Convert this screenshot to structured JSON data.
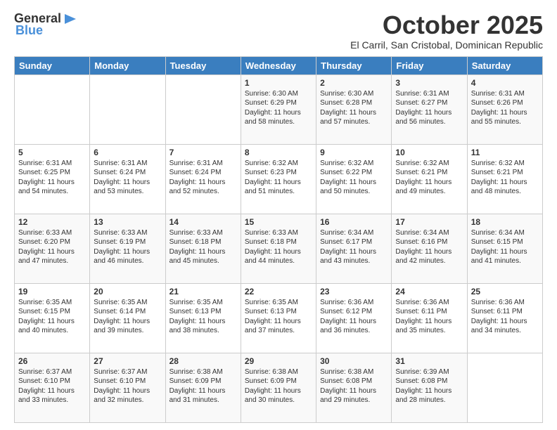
{
  "header": {
    "logo_general": "General",
    "logo_blue": "Blue",
    "month": "October 2025",
    "location": "El Carril, San Cristobal, Dominican Republic"
  },
  "days_of_week": [
    "Sunday",
    "Monday",
    "Tuesday",
    "Wednesday",
    "Thursday",
    "Friday",
    "Saturday"
  ],
  "weeks": [
    [
      {
        "day": "",
        "info": ""
      },
      {
        "day": "",
        "info": ""
      },
      {
        "day": "",
        "info": ""
      },
      {
        "day": "1",
        "info": "Sunrise: 6:30 AM\nSunset: 6:29 PM\nDaylight: 11 hours\nand 58 minutes."
      },
      {
        "day": "2",
        "info": "Sunrise: 6:30 AM\nSunset: 6:28 PM\nDaylight: 11 hours\nand 57 minutes."
      },
      {
        "day": "3",
        "info": "Sunrise: 6:31 AM\nSunset: 6:27 PM\nDaylight: 11 hours\nand 56 minutes."
      },
      {
        "day": "4",
        "info": "Sunrise: 6:31 AM\nSunset: 6:26 PM\nDaylight: 11 hours\nand 55 minutes."
      }
    ],
    [
      {
        "day": "5",
        "info": "Sunrise: 6:31 AM\nSunset: 6:25 PM\nDaylight: 11 hours\nand 54 minutes."
      },
      {
        "day": "6",
        "info": "Sunrise: 6:31 AM\nSunset: 6:24 PM\nDaylight: 11 hours\nand 53 minutes."
      },
      {
        "day": "7",
        "info": "Sunrise: 6:31 AM\nSunset: 6:24 PM\nDaylight: 11 hours\nand 52 minutes."
      },
      {
        "day": "8",
        "info": "Sunrise: 6:32 AM\nSunset: 6:23 PM\nDaylight: 11 hours\nand 51 minutes."
      },
      {
        "day": "9",
        "info": "Sunrise: 6:32 AM\nSunset: 6:22 PM\nDaylight: 11 hours\nand 50 minutes."
      },
      {
        "day": "10",
        "info": "Sunrise: 6:32 AM\nSunset: 6:21 PM\nDaylight: 11 hours\nand 49 minutes."
      },
      {
        "day": "11",
        "info": "Sunrise: 6:32 AM\nSunset: 6:21 PM\nDaylight: 11 hours\nand 48 minutes."
      }
    ],
    [
      {
        "day": "12",
        "info": "Sunrise: 6:33 AM\nSunset: 6:20 PM\nDaylight: 11 hours\nand 47 minutes."
      },
      {
        "day": "13",
        "info": "Sunrise: 6:33 AM\nSunset: 6:19 PM\nDaylight: 11 hours\nand 46 minutes."
      },
      {
        "day": "14",
        "info": "Sunrise: 6:33 AM\nSunset: 6:18 PM\nDaylight: 11 hours\nand 45 minutes."
      },
      {
        "day": "15",
        "info": "Sunrise: 6:33 AM\nSunset: 6:18 PM\nDaylight: 11 hours\nand 44 minutes."
      },
      {
        "day": "16",
        "info": "Sunrise: 6:34 AM\nSunset: 6:17 PM\nDaylight: 11 hours\nand 43 minutes."
      },
      {
        "day": "17",
        "info": "Sunrise: 6:34 AM\nSunset: 6:16 PM\nDaylight: 11 hours\nand 42 minutes."
      },
      {
        "day": "18",
        "info": "Sunrise: 6:34 AM\nSunset: 6:15 PM\nDaylight: 11 hours\nand 41 minutes."
      }
    ],
    [
      {
        "day": "19",
        "info": "Sunrise: 6:35 AM\nSunset: 6:15 PM\nDaylight: 11 hours\nand 40 minutes."
      },
      {
        "day": "20",
        "info": "Sunrise: 6:35 AM\nSunset: 6:14 PM\nDaylight: 11 hours\nand 39 minutes."
      },
      {
        "day": "21",
        "info": "Sunrise: 6:35 AM\nSunset: 6:13 PM\nDaylight: 11 hours\nand 38 minutes."
      },
      {
        "day": "22",
        "info": "Sunrise: 6:35 AM\nSunset: 6:13 PM\nDaylight: 11 hours\nand 37 minutes."
      },
      {
        "day": "23",
        "info": "Sunrise: 6:36 AM\nSunset: 6:12 PM\nDaylight: 11 hours\nand 36 minutes."
      },
      {
        "day": "24",
        "info": "Sunrise: 6:36 AM\nSunset: 6:11 PM\nDaylight: 11 hours\nand 35 minutes."
      },
      {
        "day": "25",
        "info": "Sunrise: 6:36 AM\nSunset: 6:11 PM\nDaylight: 11 hours\nand 34 minutes."
      }
    ],
    [
      {
        "day": "26",
        "info": "Sunrise: 6:37 AM\nSunset: 6:10 PM\nDaylight: 11 hours\nand 33 minutes."
      },
      {
        "day": "27",
        "info": "Sunrise: 6:37 AM\nSunset: 6:10 PM\nDaylight: 11 hours\nand 32 minutes."
      },
      {
        "day": "28",
        "info": "Sunrise: 6:38 AM\nSunset: 6:09 PM\nDaylight: 11 hours\nand 31 minutes."
      },
      {
        "day": "29",
        "info": "Sunrise: 6:38 AM\nSunset: 6:09 PM\nDaylight: 11 hours\nand 30 minutes."
      },
      {
        "day": "30",
        "info": "Sunrise: 6:38 AM\nSunset: 6:08 PM\nDaylight: 11 hours\nand 29 minutes."
      },
      {
        "day": "31",
        "info": "Sunrise: 6:39 AM\nSunset: 6:08 PM\nDaylight: 11 hours\nand 28 minutes."
      },
      {
        "day": "",
        "info": ""
      }
    ]
  ]
}
